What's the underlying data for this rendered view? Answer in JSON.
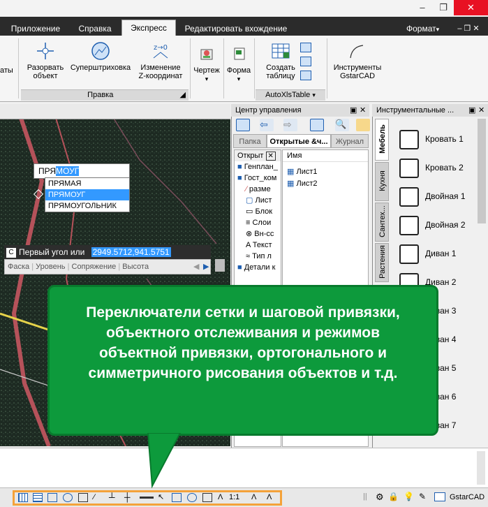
{
  "tabs": [
    "Приложение",
    "Справка",
    "Экспресс",
    "Редактировать вхождение"
  ],
  "active_tab": "Экспресс",
  "format_menu": "Формат",
  "ribbon": {
    "partial_label": "аты",
    "buttons": [
      {
        "label": "Разорвать\nобъект"
      },
      {
        "label": "Суперштриховка"
      },
      {
        "label": "Изменение\nZ-координат"
      },
      {
        "label": "Чертеж"
      },
      {
        "label": "Форма"
      },
      {
        "label": "Создать\nтаблицу"
      },
      {
        "label": "Инструменты\nGstarCAD"
      }
    ],
    "panels": [
      "Правка",
      "AutoXlsTable"
    ]
  },
  "autocomplete": {
    "typed": "ПРЯ",
    "completion": "МОУГ",
    "items": [
      "ПРЯМАЯ",
      "ПРЯМОУГ",
      "ПРЯМОУГОЛЬНИК"
    ],
    "selected": 1
  },
  "command": {
    "prompt": "Первый угол или",
    "value": "2949.5712,941.5751",
    "options": [
      "Фаска",
      "Уровень",
      "Сопряжение",
      "Высота"
    ]
  },
  "center_control": {
    "title": "Центр управления",
    "tabs": [
      "Папка",
      "Открытые &ч...",
      "Журнал"
    ],
    "tree_title": "Открыт",
    "tree": [
      "Генплан_",
      "Гост_ком",
      "разме",
      "Лист",
      "Блок",
      "Слои",
      "Вн-сс",
      "Текст",
      "Тип л",
      "Детали к"
    ],
    "column_header": "Имя",
    "files": [
      "Лист1",
      "Лист2"
    ]
  },
  "tool_palette": {
    "title": "Инструментальные ...",
    "vtabs": [
      "Мебель",
      "Кухня",
      "Сантех...",
      "Растения"
    ],
    "items": [
      "Кровать 1",
      "Кровать 2",
      "Двойная 1",
      "Двойная 2",
      "Диван 1",
      "Диван 2",
      "Диван 3",
      "Диван 4",
      "Диван 5",
      "Диван 6",
      "Диван 7"
    ]
  },
  "callout": {
    "text": "Переключатели сетки и шаговой привязки, объектного отслеживания и режимов объектной привязки, ортогонального и симметричного рисования объектов и т.д."
  },
  "status": {
    "scale": "1:1",
    "app": "GstarCAD"
  },
  "colors": {
    "callout_green": "#0d9a3c",
    "highlight_orange": "#f4a23a",
    "selection_blue": "#3399ff",
    "ribbon_dark": "#2b2b2b"
  }
}
